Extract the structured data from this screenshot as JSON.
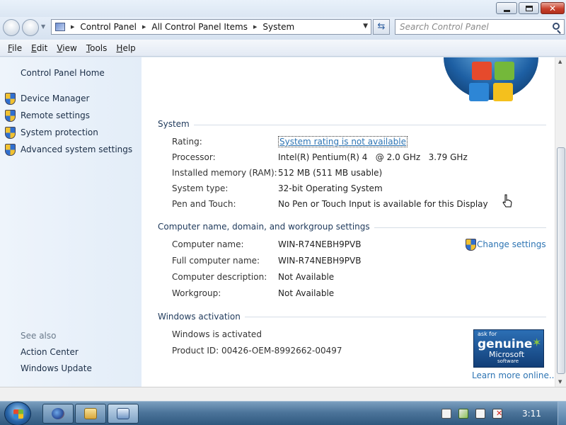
{
  "window": {
    "controls": {
      "minimize": "minimize",
      "maximize": "maximize",
      "close": "✕"
    }
  },
  "address": {
    "crumbs": [
      "Control Panel",
      "All Control Panel Items",
      "System"
    ],
    "search_placeholder": "Search Control Panel"
  },
  "menu": [
    "File",
    "Edit",
    "View",
    "Tools",
    "Help"
  ],
  "left_pane": {
    "home": "Control Panel Home",
    "tasks": [
      "Device Manager",
      "Remote settings",
      "System protection",
      "Advanced system settings"
    ],
    "see_also_title": "See also",
    "see_also": [
      "Action Center",
      "Windows Update"
    ]
  },
  "system": {
    "title": "System",
    "rows": [
      {
        "label": "Rating:",
        "value": "System rating is not available"
      },
      {
        "label": "Processor:",
        "value": "Intel(R) Pentium(R) 4   @ 2.0 GHz   3.79 GHz"
      },
      {
        "label": "Installed memory (RAM):",
        "value": "512 MB (511 MB usable)"
      },
      {
        "label": "System type:",
        "value": "32-bit Operating System"
      },
      {
        "label": "Pen and Touch:",
        "value": "No Pen or Touch Input is available for this Display"
      }
    ]
  },
  "computer": {
    "title": "Computer name, domain, and workgroup settings",
    "change_settings": "Change settings",
    "rows": [
      {
        "label": "Computer name:",
        "value": "WIN-R74NEBH9PVB"
      },
      {
        "label": "Full computer name:",
        "value": "WIN-R74NEBH9PVB"
      },
      {
        "label": "Computer description:",
        "value": "Not Available"
      },
      {
        "label": "Workgroup:",
        "value": "Not Available"
      }
    ]
  },
  "activation": {
    "title": "Windows activation",
    "status": "Windows is activated",
    "product_id": "Product ID: 00426-OEM-8992662-00497",
    "learn_more": "Learn more online...",
    "badge": {
      "line1": "ask for",
      "line2": "genuine",
      "line3": "Microsoft",
      "line4": "software"
    }
  },
  "taskbar": {
    "clock": "3:11",
    "buttons": [
      "firefox-icon",
      "folder-icon",
      "control-panel-icon"
    ]
  },
  "colors": {
    "link": "#2d74b3",
    "section_title": "#1e395b",
    "close_button": "#c9422e",
    "taskbar": "#4d759b"
  }
}
